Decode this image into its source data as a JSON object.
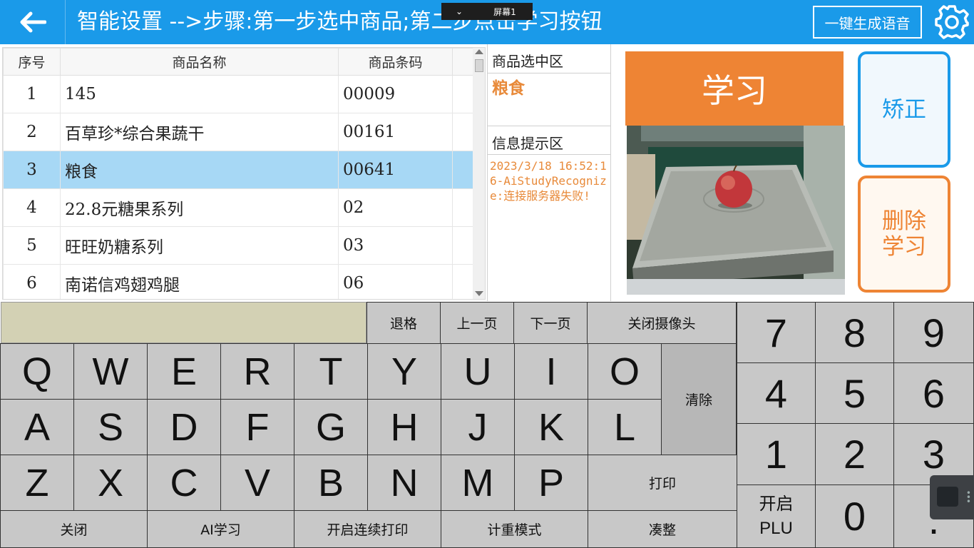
{
  "header": {
    "title": "智能设置  -->步骤:第一步选中商品;第二步点击学习按钮",
    "screen_tab": "屏幕1",
    "voice_button": "一键生成语音"
  },
  "table": {
    "columns": [
      "序号",
      "商品名称",
      "商品条码"
    ],
    "rows": [
      {
        "idx": "1",
        "name": "145",
        "code": "00009"
      },
      {
        "idx": "2",
        "name": "百草珍*综合果蔬干",
        "code": "00161"
      },
      {
        "idx": "3",
        "name": "粮食",
        "code": "00641",
        "selected": true
      },
      {
        "idx": "4",
        "name": "22.8元糖果系列",
        "code": "02"
      },
      {
        "idx": "5",
        "name": "旺旺奶糖系列",
        "code": "03"
      },
      {
        "idx": "6",
        "name": "南诺信鸡翅鸡腿",
        "code": "06"
      }
    ]
  },
  "info": {
    "selected_label": "商品选中区",
    "selected_value": "粮食",
    "hint_label": "信息提示区",
    "message": "2023/3/18 16:52:16-AiStudyRecognize:连接服务器失败!"
  },
  "buttons": {
    "learn": "学习",
    "correct": "矫正",
    "delete_line1": "删除",
    "delete_line2": "学习"
  },
  "keyboard": {
    "backspace": "退格",
    "prev_page": "上一页",
    "next_page": "下一页",
    "close_camera": "关闭摄像头",
    "clear": "清除",
    "print": "打印",
    "close": "关闭",
    "ai_learn": "AI学习",
    "continuous_print": "开启连续打印",
    "weighing_mode": "计重模式",
    "round": "凑整",
    "open_plu_line1": "开启",
    "open_plu_line2": "PLU",
    "row1": [
      "Q",
      "W",
      "E",
      "R",
      "T",
      "Y",
      "U",
      "I",
      "O"
    ],
    "row2": [
      "A",
      "S",
      "D",
      "F",
      "G",
      "H",
      "J",
      "K",
      "L"
    ],
    "row3": [
      "Z",
      "X",
      "C",
      "V",
      "B",
      "N",
      "M",
      "P"
    ],
    "numpad": [
      "7",
      "8",
      "9",
      "4",
      "5",
      "6",
      "1",
      "2",
      "3",
      "0",
      "."
    ]
  },
  "colors": {
    "header_blue": "#1a9ae9",
    "accent_orange": "#ee8434",
    "selected_row": "#a7d8f5",
    "key_gray": "#c8c8c8"
  }
}
